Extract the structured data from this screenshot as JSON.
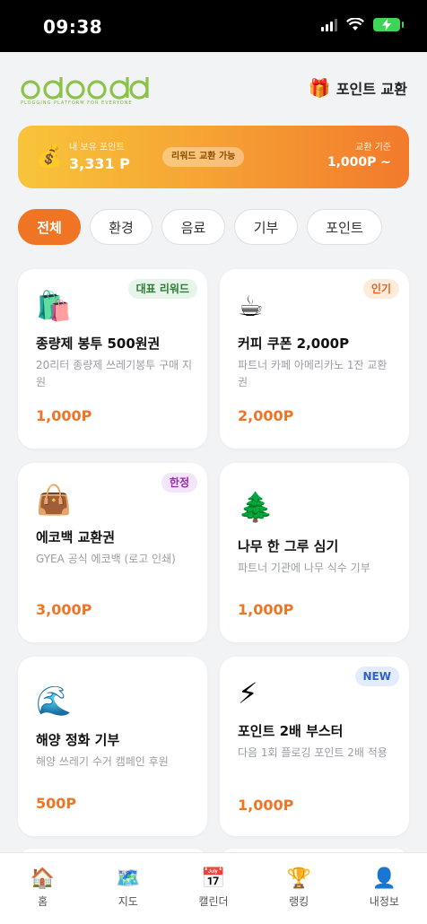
{
  "status_bar": {
    "time": "09:38"
  },
  "header": {
    "logo_text": "odoodd",
    "logo_subtitle": "PLOGGING PLATFORM FOR EVERYONE",
    "exchange_icon": "gift-icon",
    "exchange_label": "포인트 교환"
  },
  "banner": {
    "icon": "money-bag-icon",
    "my_points_label": "내 보유 포인트",
    "my_points_value": "3,331 P",
    "available_badge": "리워드 교환 가능",
    "standard_label": "교환 기준",
    "standard_value": "1,000P ~"
  },
  "tabs": [
    {
      "label": "전체",
      "active": true
    },
    {
      "label": "환경",
      "active": false
    },
    {
      "label": "음료",
      "active": false
    },
    {
      "label": "기부",
      "active": false
    },
    {
      "label": "포인트",
      "active": false
    }
  ],
  "rewards": [
    {
      "icon": "shopping-bags-icon",
      "emoji": "🛍️",
      "badge": "대표 리워드",
      "badge_color": "#e6f4ea",
      "badge_text_color": "#2e7d32",
      "title": "종량제 봉투 500원권",
      "desc": "20리터 종량제 쓰레기봉투 구매 지원",
      "price": "1,000P"
    },
    {
      "icon": "coffee-icon",
      "emoji": "☕",
      "badge": "인기",
      "badge_color": "#fdebdc",
      "badge_text_color": "#e8661a",
      "title": "커피 쿠폰 2,000P",
      "desc": "파트너 카페 아메리카노 1잔 교환권",
      "price": "2,000P"
    },
    {
      "icon": "handbag-icon",
      "emoji": "👜",
      "badge": "한정",
      "badge_color": "#f3e5fb",
      "badge_text_color": "#9c27b0",
      "title": "에코백 교환권",
      "desc": "GYEA 공식 에코백 (로고 인쇄)",
      "price": "3,000P"
    },
    {
      "icon": "tree-icon",
      "emoji": "🌲",
      "badge": "",
      "badge_color": "",
      "badge_text_color": "",
      "title": "나무 한 그루 심기",
      "desc": "파트너 기관에 나무 식수 기부",
      "price": "1,000P"
    },
    {
      "icon": "wave-icon",
      "emoji": "🌊",
      "badge": "",
      "badge_color": "",
      "badge_text_color": "",
      "title": "해양 정화 기부",
      "desc": "해양 쓰레기 수거 캠페인 후원",
      "price": "500P"
    },
    {
      "icon": "lightning-icon",
      "emoji": "⚡",
      "badge": "NEW",
      "badge_color": "#e3ecfd",
      "badge_text_color": "#2f5fd0",
      "title": "포인트 2배 부스터",
      "desc": "다음 1회 플로깅 포인트 2배 적용",
      "price": "1,000P"
    }
  ],
  "tabbar": [
    {
      "icon": "home-icon",
      "emoji": "🏠",
      "label": "홈"
    },
    {
      "icon": "map-icon",
      "emoji": "🗺️",
      "label": "지도"
    },
    {
      "icon": "calendar-icon",
      "emoji": "📅",
      "label": "캘린더"
    },
    {
      "icon": "trophy-icon",
      "emoji": "🏆",
      "label": "랭킹"
    },
    {
      "icon": "user-icon",
      "emoji": "👤",
      "label": "내정보"
    }
  ]
}
